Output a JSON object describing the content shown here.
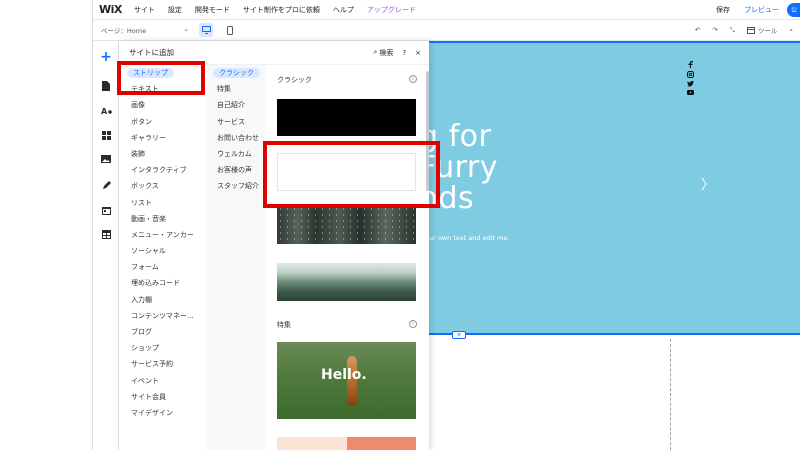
{
  "topbar": {
    "logo": "WiX",
    "nav": [
      "サイト",
      "設定",
      "開発モード",
      "サイト制作をプロに依頼",
      "ヘルプ"
    ],
    "upgrade": "アップグレード",
    "save": "保存",
    "preview": "プレビュー",
    "publish": "公"
  },
  "toolbar2": {
    "page_select": "ページ：Home",
    "tools_label": "ツール"
  },
  "panel": {
    "title": "サイトに追加",
    "search_label": "検索",
    "help": "?",
    "close": "×",
    "categories": [
      "ストリップ",
      "テキスト",
      "画像",
      "ボタン",
      "ギャラリー",
      "装飾",
      "インタラクティブ",
      "ボックス",
      "リスト",
      "動画・音楽",
      "メニュー・アンカー",
      "ソーシャル",
      "フォーム",
      "埋め込みコード",
      "入力欄",
      "コンテンツマネー...",
      "ブログ",
      "ショップ",
      "サービス予約",
      "イベント",
      "サイト会員",
      "マイデザイン"
    ],
    "subcategories": [
      "クラシック",
      "特集",
      "自己紹介",
      "サービス",
      "お問い合わせ",
      "ウェルカム",
      "お客様の声",
      "スタッフ紹介"
    ],
    "section_classic": "クラシック",
    "section_featured": "特集",
    "hello_text": "Hello."
  },
  "canvas": {
    "hero_line1": "g for",
    "hero_line2": "Furry",
    "hero_line3": "nds",
    "hero_sub": "our own text and edit me."
  },
  "colors": {
    "accent": "#116dff",
    "hero_bg": "#7ecbe2",
    "highlight": "#e00000",
    "upgrade": "#9a4dff"
  }
}
